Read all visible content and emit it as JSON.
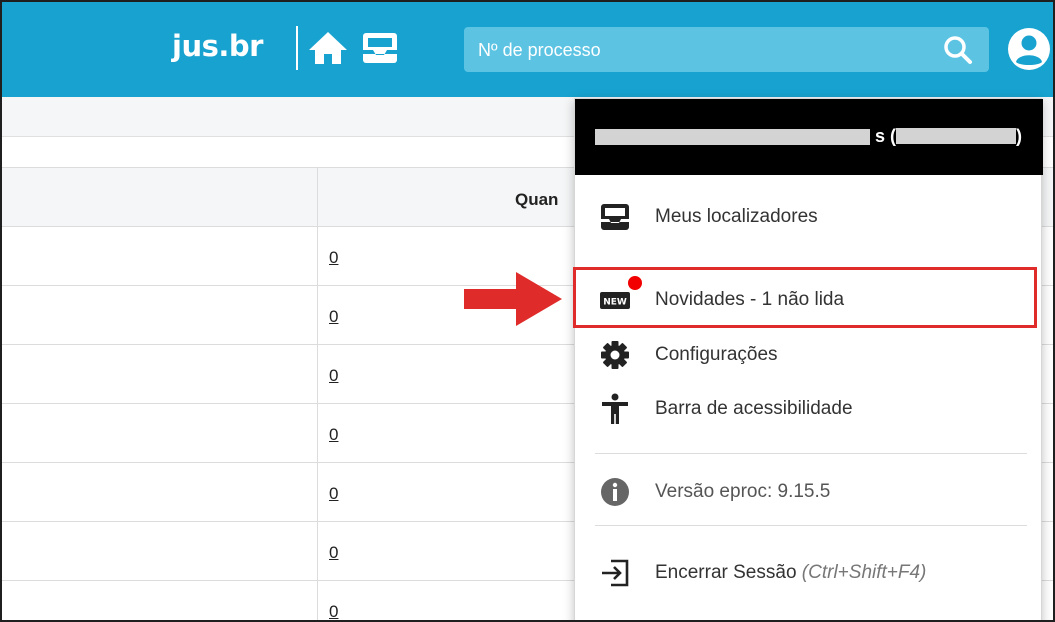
{
  "header": {
    "brand": "jus.br",
    "search_placeholder": "Nº de processo",
    "icons": [
      "home-icon",
      "inbox-icon",
      "search-icon",
      "user-circle-icon"
    ],
    "colors": {
      "bar": "#17a2cf",
      "search_bg": "#5cc3e3"
    }
  },
  "table": {
    "column_header": "Quan",
    "rows": [
      "0",
      "0",
      "0",
      "0",
      "0",
      "0",
      "0"
    ]
  },
  "user_menu": {
    "user_label": "s (",
    "user_label_end": ")",
    "items": [
      {
        "label": "Meus localizadores",
        "icon": "inbox-icon"
      },
      {
        "label": "Novidades - 1 não lida",
        "icon": "new-badge-icon"
      },
      {
        "label": "Configurações",
        "icon": "gear-icon"
      },
      {
        "label": "Barra de acessibilidade",
        "icon": "accessibility-icon"
      }
    ],
    "version": {
      "label": "Versão eproc: 9.15.5",
      "icon": "info-icon"
    },
    "logout": {
      "label": "Encerrar Sessão",
      "shortcut": "(Ctrl+Shift+F4)",
      "icon": "logout-icon"
    },
    "colors": {
      "header_bg": "#000000",
      "highlight": "#e02b2b",
      "unread_dot": "#f20000"
    }
  }
}
